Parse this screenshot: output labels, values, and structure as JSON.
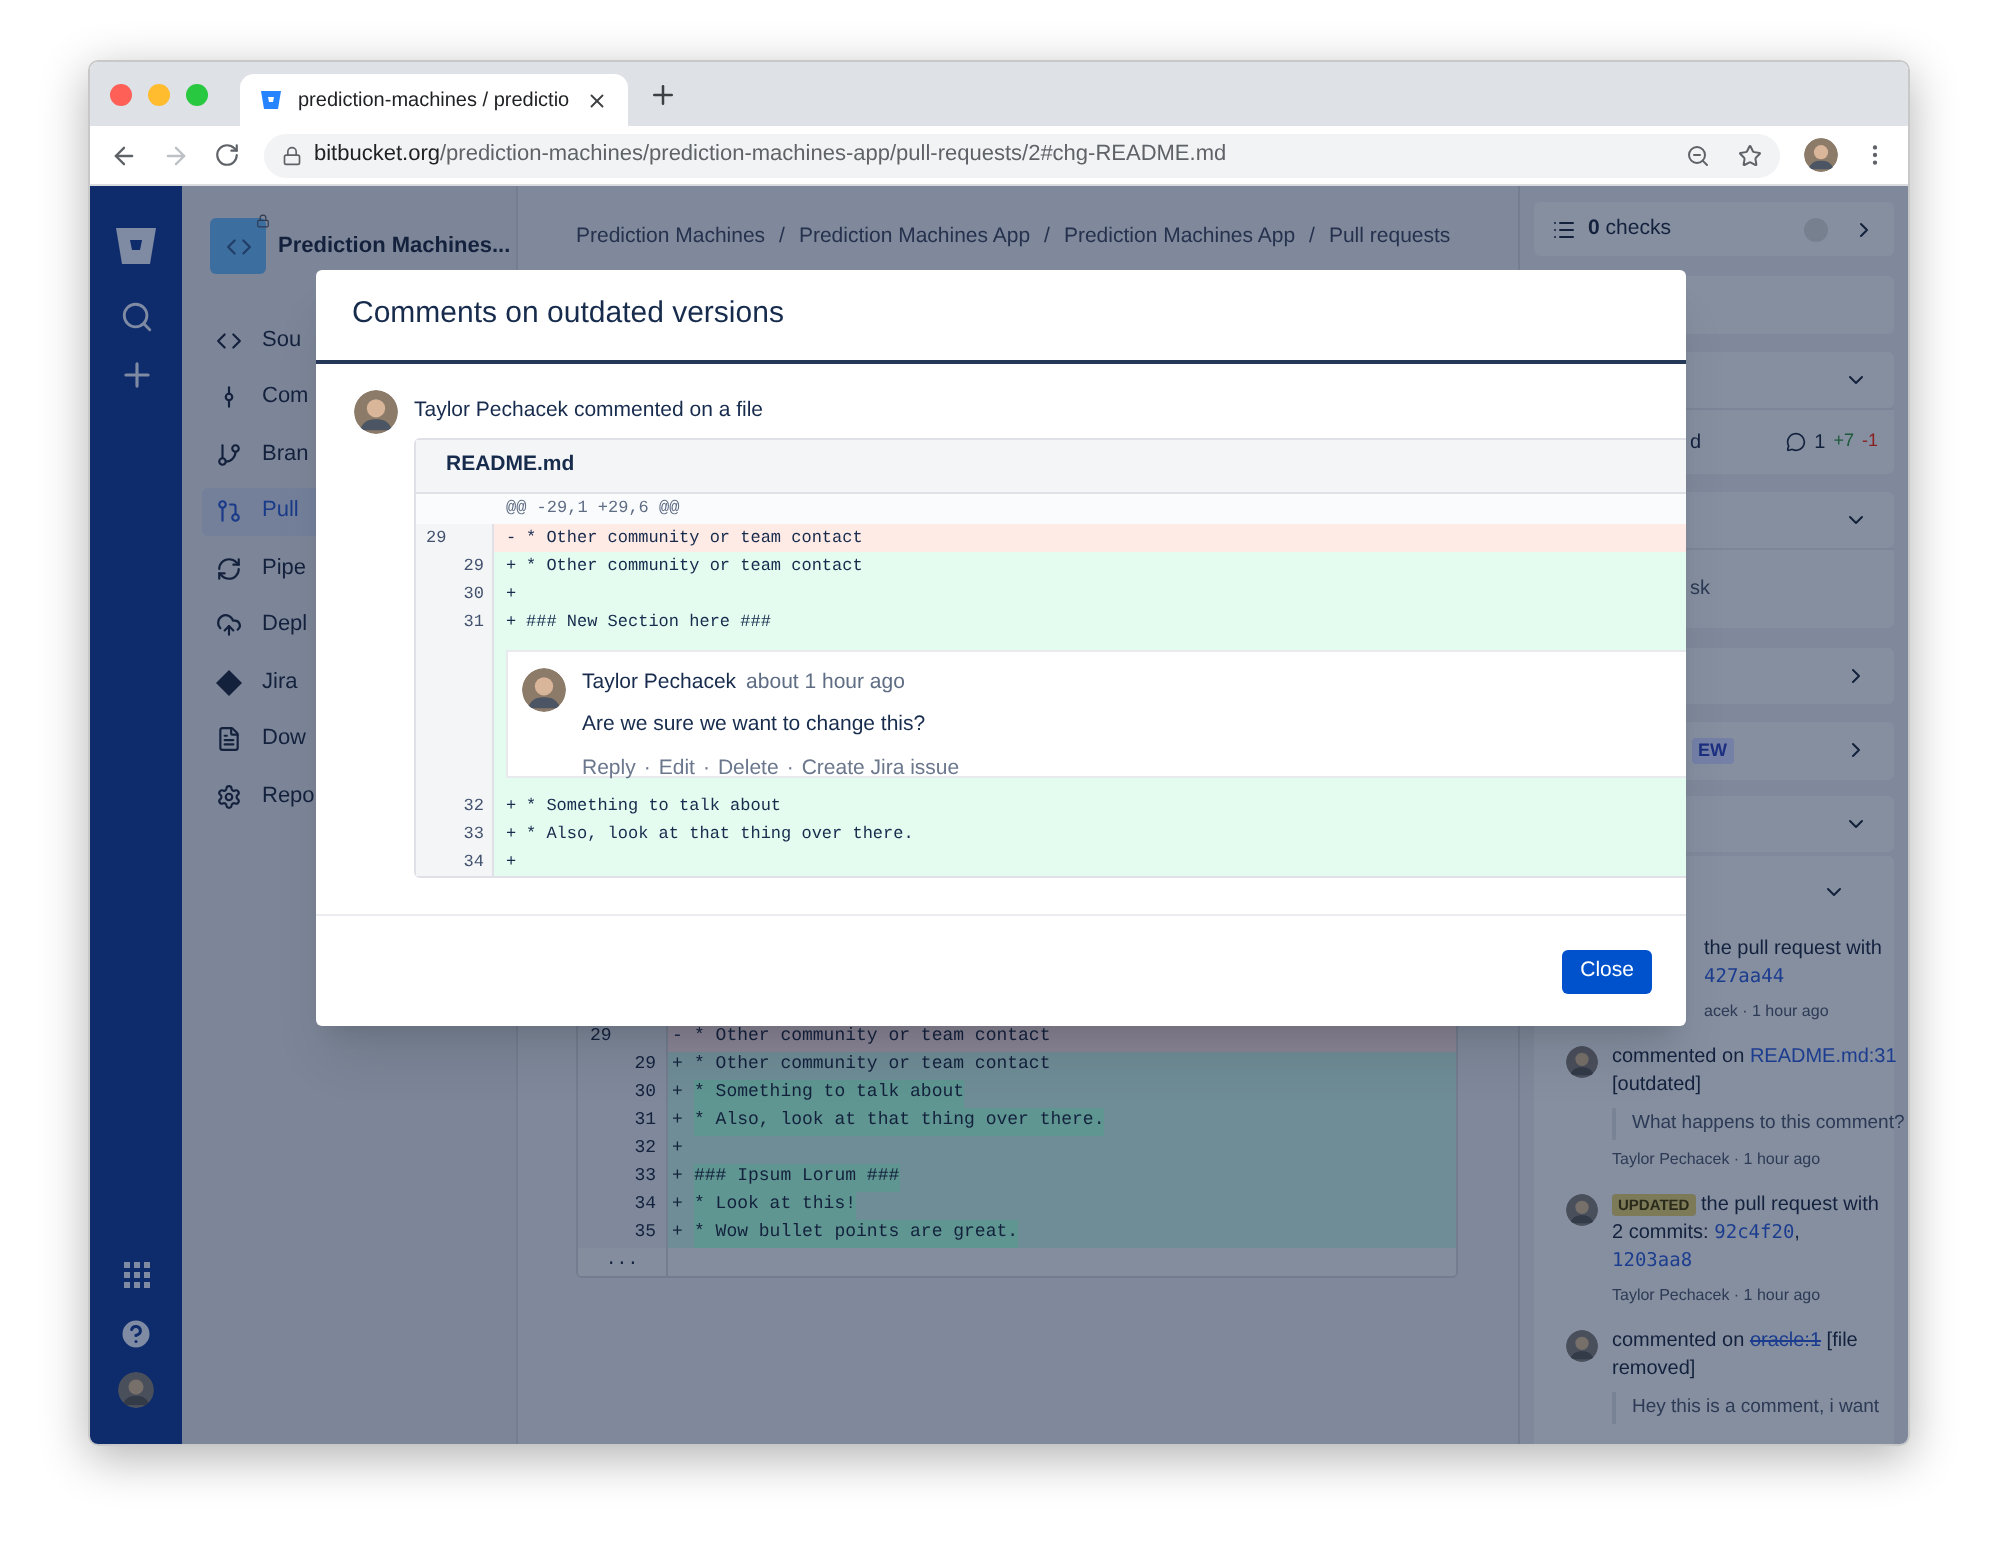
{
  "browser": {
    "tab_title": "prediction-machines / predictio",
    "url_host": "bitbucket.org",
    "url_path": "/prediction-machines/prediction-machines-app/pull-requests/2#chg-README.md"
  },
  "sidebar": {
    "project_name": "Prediction Machines...",
    "items": [
      {
        "label": "Sou",
        "selected": false
      },
      {
        "label": "Com",
        "selected": false
      },
      {
        "label": "Bran",
        "selected": false
      },
      {
        "label": "Pull",
        "selected": true
      },
      {
        "label": "Pipe",
        "selected": false
      },
      {
        "label": "Depl",
        "selected": false
      },
      {
        "label": "Jira",
        "selected": false
      },
      {
        "label": "Dow",
        "selected": false
      },
      {
        "label": "Repo",
        "selected": false
      }
    ]
  },
  "breadcrumbs": [
    "Prediction Machines",
    "Prediction Machines App",
    "Prediction Machines App",
    "Pull requests"
  ],
  "breadcrumb_separator": "/",
  "background_diff": {
    "rows": [
      {
        "kind": "removed",
        "old": "29",
        "prefix": "-",
        "text": "* Other community or team contact",
        "highlight": false
      },
      {
        "kind": "added",
        "new": "29",
        "prefix": "+",
        "text": "* Other community or team contact",
        "highlight": false
      },
      {
        "kind": "added",
        "new": "30",
        "prefix": "+",
        "text": "* Something to talk about",
        "highlight": true
      },
      {
        "kind": "added",
        "new": "31",
        "prefix": "+",
        "text": "* Also, look at that thing over there.",
        "highlight": true
      },
      {
        "kind": "added",
        "new": "32",
        "prefix": "+"
      },
      {
        "kind": "added",
        "new": "33",
        "prefix": "+",
        "text": "### Ipsum Lorum ###",
        "highlight": true
      },
      {
        "kind": "added",
        "new": "34",
        "prefix": "+",
        "text": "* Look at this!",
        "highlight": true
      },
      {
        "kind": "added",
        "new": "35",
        "prefix": "+",
        "text": "* Wow bullet points are great.",
        "highlight": true
      },
      {
        "kind": "expander",
        "old": "..."
      }
    ]
  },
  "right_panel": {
    "sections": [
      {
        "kind": "checks",
        "count": "0",
        "label": "checks"
      },
      {
        "kind": "blank"
      },
      {
        "kind": "header",
        "expanded": true
      },
      {
        "kind": "file",
        "text": "d",
        "comments": "1",
        "added": "+7",
        "removed": "-1"
      },
      {
        "kind": "header",
        "expanded": true
      },
      {
        "kind": "task",
        "text": "sk"
      },
      {
        "kind": "header",
        "expanded": false
      },
      {
        "kind": "header",
        "expanded": false,
        "badge": "EW"
      },
      {
        "kind": "header",
        "expanded": true
      }
    ],
    "activity": {
      "expanded": true,
      "items": [
        {
          "lines": [
            [
              {
                "kind": "text",
                "text": "the pull request with"
              }
            ],
            [
              {
                "kind": "code",
                "text": "427aa44"
              }
            ]
          ],
          "meta": "acek · 1 hour ago"
        },
        {
          "avatar": true,
          "lines": [
            [
              {
                "kind": "text",
                "text": "commented on "
              },
              {
                "kind": "link",
                "text": "README.md:31"
              }
            ],
            [
              {
                "kind": "text",
                "text": "[outdated]"
              }
            ]
          ],
          "quote": "What happens to this comment?",
          "meta": "Taylor Pechacek · 1 hour ago"
        },
        {
          "avatar": true,
          "lines": [
            [
              {
                "kind": "badge",
                "text": "UPDATED"
              },
              {
                "kind": "text",
                "text": " the pull request with"
              }
            ],
            [
              {
                "kind": "text",
                "text": "2 commits: "
              },
              {
                "kind": "code",
                "text": "92c4f20"
              },
              {
                "kind": "text",
                "text": ","
              }
            ],
            [
              {
                "kind": "code",
                "text": "1203aa8"
              }
            ]
          ],
          "meta": "Taylor Pechacek · 1 hour ago"
        },
        {
          "avatar": true,
          "lines": [
            [
              {
                "kind": "text",
                "text": "commented on "
              },
              {
                "kind": "struck",
                "text": "oracle:1"
              },
              {
                "kind": "text",
                "text": " [file"
              }
            ],
            [
              {
                "kind": "text",
                "text": "removed]"
              }
            ]
          ],
          "quote": "Hey this is a comment, i want"
        }
      ]
    }
  },
  "modal": {
    "title": "Comments on outdated versions",
    "comment_header": "Taylor Pechacek commented on a file",
    "file_name": "README.md",
    "hunk": "@@ -29,1 +29,6 @@",
    "lines": [
      {
        "kind": "removed",
        "old": "29",
        "prefix": "-",
        "text": "* Other community or team contact"
      },
      {
        "kind": "added",
        "new": "29",
        "prefix": "+",
        "text": "* Other community or team contact"
      },
      {
        "kind": "added",
        "new": "30",
        "prefix": "+"
      },
      {
        "kind": "added",
        "new": "31",
        "prefix": "+",
        "text": "### New Section here ###"
      },
      {
        "kind": "comment",
        "author": "Taylor Pechacek",
        "time": "about 1 hour ago",
        "body": "Are we sure we want to change this?",
        "actions": [
          "Reply",
          "Edit",
          "Delete",
          "Create Jira issue"
        ],
        "separator": "·"
      },
      {
        "kind": "added",
        "new": "32",
        "prefix": "+",
        "text": "* Something to talk about"
      },
      {
        "kind": "added",
        "new": "33",
        "prefix": "+",
        "text": "* Also, look at that thing over there."
      },
      {
        "kind": "added",
        "new": "34",
        "prefix": "+"
      }
    ],
    "close_button": "Close"
  }
}
